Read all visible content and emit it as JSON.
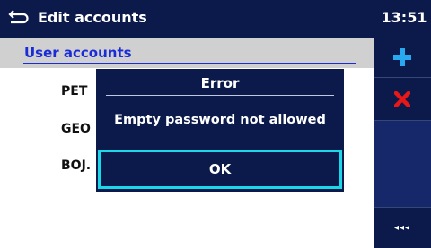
{
  "header": {
    "title": "Edit accounts",
    "time": "13:51",
    "back_icon": "back-arrow-icon"
  },
  "section": {
    "title": "User accounts"
  },
  "accounts": [
    {
      "name": "PET"
    },
    {
      "name": "GEO"
    },
    {
      "name": "BOJ."
    }
  ],
  "toolbar": {
    "add_icon": "plus-icon",
    "delete_icon": "close-x-icon",
    "more_label": "◂◂◂"
  },
  "dialog": {
    "title": "Error",
    "message": "Empty password not allowed",
    "ok_label": "OK"
  },
  "colors": {
    "header_bg": "#0b1a4a",
    "accent_blue": "#1a2bd8",
    "add_icon": "#28a8f0",
    "delete_icon": "#e81818",
    "focus_border": "#1ad8e8",
    "section_bg": "#d0d0d0"
  }
}
